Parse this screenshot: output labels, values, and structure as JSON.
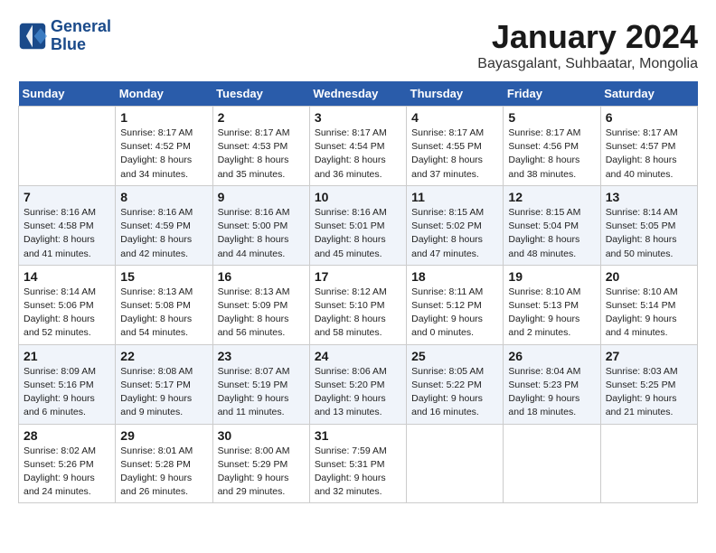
{
  "header": {
    "logo_line1": "General",
    "logo_line2": "Blue",
    "month": "January 2024",
    "location": "Bayasgalant, Suhbaatar, Mongolia"
  },
  "days_of_week": [
    "Sunday",
    "Monday",
    "Tuesday",
    "Wednesday",
    "Thursday",
    "Friday",
    "Saturday"
  ],
  "weeks": [
    [
      {
        "day": "",
        "sunrise": "",
        "sunset": "",
        "daylight": ""
      },
      {
        "day": "1",
        "sunrise": "Sunrise: 8:17 AM",
        "sunset": "Sunset: 4:52 PM",
        "daylight": "Daylight: 8 hours and 34 minutes."
      },
      {
        "day": "2",
        "sunrise": "Sunrise: 8:17 AM",
        "sunset": "Sunset: 4:53 PM",
        "daylight": "Daylight: 8 hours and 35 minutes."
      },
      {
        "day": "3",
        "sunrise": "Sunrise: 8:17 AM",
        "sunset": "Sunset: 4:54 PM",
        "daylight": "Daylight: 8 hours and 36 minutes."
      },
      {
        "day": "4",
        "sunrise": "Sunrise: 8:17 AM",
        "sunset": "Sunset: 4:55 PM",
        "daylight": "Daylight: 8 hours and 37 minutes."
      },
      {
        "day": "5",
        "sunrise": "Sunrise: 8:17 AM",
        "sunset": "Sunset: 4:56 PM",
        "daylight": "Daylight: 8 hours and 38 minutes."
      },
      {
        "day": "6",
        "sunrise": "Sunrise: 8:17 AM",
        "sunset": "Sunset: 4:57 PM",
        "daylight": "Daylight: 8 hours and 40 minutes."
      }
    ],
    [
      {
        "day": "7",
        "sunrise": "Sunrise: 8:16 AM",
        "sunset": "Sunset: 4:58 PM",
        "daylight": "Daylight: 8 hours and 41 minutes."
      },
      {
        "day": "8",
        "sunrise": "Sunrise: 8:16 AM",
        "sunset": "Sunset: 4:59 PM",
        "daylight": "Daylight: 8 hours and 42 minutes."
      },
      {
        "day": "9",
        "sunrise": "Sunrise: 8:16 AM",
        "sunset": "Sunset: 5:00 PM",
        "daylight": "Daylight: 8 hours and 44 minutes."
      },
      {
        "day": "10",
        "sunrise": "Sunrise: 8:16 AM",
        "sunset": "Sunset: 5:01 PM",
        "daylight": "Daylight: 8 hours and 45 minutes."
      },
      {
        "day": "11",
        "sunrise": "Sunrise: 8:15 AM",
        "sunset": "Sunset: 5:02 PM",
        "daylight": "Daylight: 8 hours and 47 minutes."
      },
      {
        "day": "12",
        "sunrise": "Sunrise: 8:15 AM",
        "sunset": "Sunset: 5:04 PM",
        "daylight": "Daylight: 8 hours and 48 minutes."
      },
      {
        "day": "13",
        "sunrise": "Sunrise: 8:14 AM",
        "sunset": "Sunset: 5:05 PM",
        "daylight": "Daylight: 8 hours and 50 minutes."
      }
    ],
    [
      {
        "day": "14",
        "sunrise": "Sunrise: 8:14 AM",
        "sunset": "Sunset: 5:06 PM",
        "daylight": "Daylight: 8 hours and 52 minutes."
      },
      {
        "day": "15",
        "sunrise": "Sunrise: 8:13 AM",
        "sunset": "Sunset: 5:08 PM",
        "daylight": "Daylight: 8 hours and 54 minutes."
      },
      {
        "day": "16",
        "sunrise": "Sunrise: 8:13 AM",
        "sunset": "Sunset: 5:09 PM",
        "daylight": "Daylight: 8 hours and 56 minutes."
      },
      {
        "day": "17",
        "sunrise": "Sunrise: 8:12 AM",
        "sunset": "Sunset: 5:10 PM",
        "daylight": "Daylight: 8 hours and 58 minutes."
      },
      {
        "day": "18",
        "sunrise": "Sunrise: 8:11 AM",
        "sunset": "Sunset: 5:12 PM",
        "daylight": "Daylight: 9 hours and 0 minutes."
      },
      {
        "day": "19",
        "sunrise": "Sunrise: 8:10 AM",
        "sunset": "Sunset: 5:13 PM",
        "daylight": "Daylight: 9 hours and 2 minutes."
      },
      {
        "day": "20",
        "sunrise": "Sunrise: 8:10 AM",
        "sunset": "Sunset: 5:14 PM",
        "daylight": "Daylight: 9 hours and 4 minutes."
      }
    ],
    [
      {
        "day": "21",
        "sunrise": "Sunrise: 8:09 AM",
        "sunset": "Sunset: 5:16 PM",
        "daylight": "Daylight: 9 hours and 6 minutes."
      },
      {
        "day": "22",
        "sunrise": "Sunrise: 8:08 AM",
        "sunset": "Sunset: 5:17 PM",
        "daylight": "Daylight: 9 hours and 9 minutes."
      },
      {
        "day": "23",
        "sunrise": "Sunrise: 8:07 AM",
        "sunset": "Sunset: 5:19 PM",
        "daylight": "Daylight: 9 hours and 11 minutes."
      },
      {
        "day": "24",
        "sunrise": "Sunrise: 8:06 AM",
        "sunset": "Sunset: 5:20 PM",
        "daylight": "Daylight: 9 hours and 13 minutes."
      },
      {
        "day": "25",
        "sunrise": "Sunrise: 8:05 AM",
        "sunset": "Sunset: 5:22 PM",
        "daylight": "Daylight: 9 hours and 16 minutes."
      },
      {
        "day": "26",
        "sunrise": "Sunrise: 8:04 AM",
        "sunset": "Sunset: 5:23 PM",
        "daylight": "Daylight: 9 hours and 18 minutes."
      },
      {
        "day": "27",
        "sunrise": "Sunrise: 8:03 AM",
        "sunset": "Sunset: 5:25 PM",
        "daylight": "Daylight: 9 hours and 21 minutes."
      }
    ],
    [
      {
        "day": "28",
        "sunrise": "Sunrise: 8:02 AM",
        "sunset": "Sunset: 5:26 PM",
        "daylight": "Daylight: 9 hours and 24 minutes."
      },
      {
        "day": "29",
        "sunrise": "Sunrise: 8:01 AM",
        "sunset": "Sunset: 5:28 PM",
        "daylight": "Daylight: 9 hours and 26 minutes."
      },
      {
        "day": "30",
        "sunrise": "Sunrise: 8:00 AM",
        "sunset": "Sunset: 5:29 PM",
        "daylight": "Daylight: 9 hours and 29 minutes."
      },
      {
        "day": "31",
        "sunrise": "Sunrise: 7:59 AM",
        "sunset": "Sunset: 5:31 PM",
        "daylight": "Daylight: 9 hours and 32 minutes."
      },
      {
        "day": "",
        "sunrise": "",
        "sunset": "",
        "daylight": ""
      },
      {
        "day": "",
        "sunrise": "",
        "sunset": "",
        "daylight": ""
      },
      {
        "day": "",
        "sunrise": "",
        "sunset": "",
        "daylight": ""
      }
    ]
  ]
}
